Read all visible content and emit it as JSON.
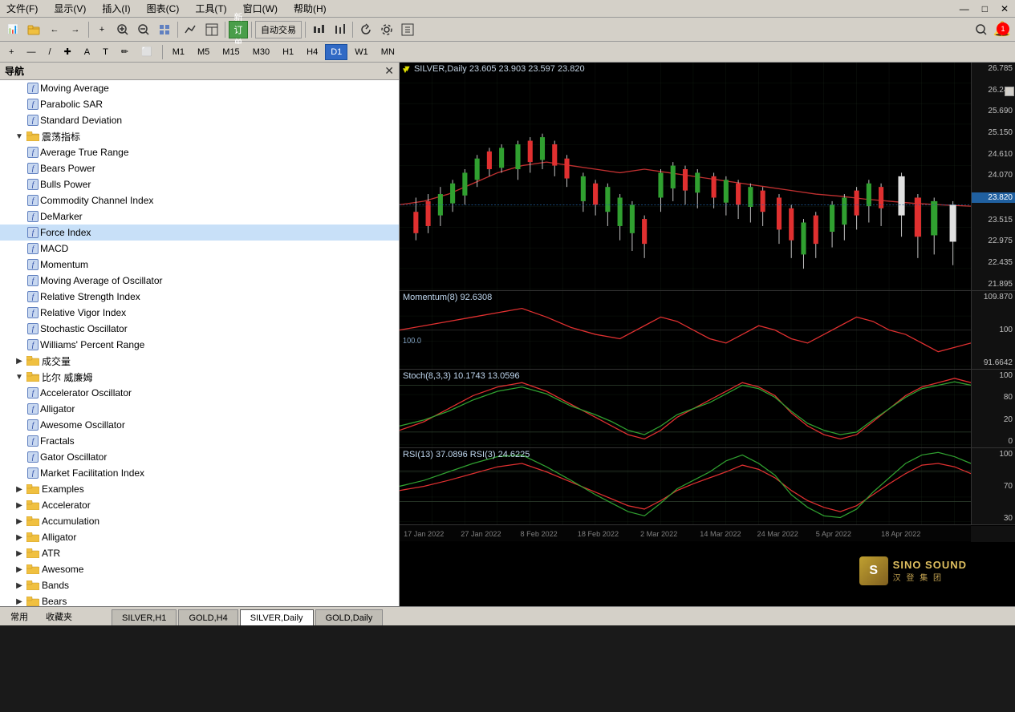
{
  "menubar": {
    "items": [
      "文件(F)",
      "显示(V)",
      "插入(I)",
      "图表(C)",
      "工具(T)",
      "窗口(W)",
      "帮助(H)"
    ]
  },
  "toolbar": {
    "buttons": [
      "⬜",
      "📁",
      "🖹",
      "↩",
      "↪",
      "✂",
      "📋",
      "🗑",
      "📊",
      "📈",
      "🖊",
      "🔷",
      "A",
      "T",
      "✏",
      "☑"
    ],
    "new_order": "新订单",
    "auto_trade": "自动交易"
  },
  "toolbar2": {
    "drawing_tools": [
      "+",
      "—",
      "/",
      "✚",
      "A",
      "T",
      "✏",
      "⬜"
    ],
    "timeframes": [
      "M1",
      "M5",
      "M15",
      "M30",
      "H1",
      "H4",
      "D1",
      "W1",
      "MN"
    ]
  },
  "sidebar": {
    "title": "导航",
    "tabs": [
      "常用",
      "收藏夹"
    ],
    "tree": [
      {
        "id": "moving-average",
        "label": "Moving Average",
        "type": "func",
        "indent": 2
      },
      {
        "id": "parabolic-sar",
        "label": "Parabolic SAR",
        "type": "func",
        "indent": 2
      },
      {
        "id": "standard-deviation",
        "label": "Standard Deviation",
        "type": "func",
        "indent": 2
      },
      {
        "id": "zhenfu",
        "label": "震荡指标",
        "type": "folder-open",
        "indent": 1
      },
      {
        "id": "average-true-range",
        "label": "Average True Range",
        "type": "func",
        "indent": 2
      },
      {
        "id": "bears-power",
        "label": "Bears Power",
        "type": "func",
        "indent": 2
      },
      {
        "id": "bulls-power",
        "label": "Bulls Power",
        "type": "func",
        "indent": 2
      },
      {
        "id": "commodity-channel-index",
        "label": "Commodity Channel Index",
        "type": "func",
        "indent": 2
      },
      {
        "id": "demarker",
        "label": "DeMarker",
        "type": "func",
        "indent": 2
      },
      {
        "id": "force-index",
        "label": "Force Index",
        "type": "func",
        "indent": 2
      },
      {
        "id": "macd",
        "label": "MACD",
        "type": "func",
        "indent": 2
      },
      {
        "id": "momentum",
        "label": "Momentum",
        "type": "func",
        "indent": 2
      },
      {
        "id": "moving-average-oscillator",
        "label": "Moving Average of Oscillator",
        "type": "func",
        "indent": 2
      },
      {
        "id": "relative-strength-index",
        "label": "Relative Strength Index",
        "type": "func",
        "indent": 2
      },
      {
        "id": "relative-vigor-index",
        "label": "Relative Vigor Index",
        "type": "func",
        "indent": 2
      },
      {
        "id": "stochastic-oscillator",
        "label": "Stochastic Oscillator",
        "type": "func",
        "indent": 2
      },
      {
        "id": "williams-percent-range",
        "label": "Williams' Percent Range",
        "type": "func",
        "indent": 2
      },
      {
        "id": "chengjiaoliang",
        "label": "成交量",
        "type": "folder-open",
        "indent": 1
      },
      {
        "id": "bier-william",
        "label": "比尔 威廉姆",
        "type": "folder-open",
        "indent": 1
      },
      {
        "id": "accelerator-oscillator",
        "label": "Accelerator Oscillator",
        "type": "func",
        "indent": 2
      },
      {
        "id": "alligator",
        "label": "Alligator",
        "type": "func",
        "indent": 2
      },
      {
        "id": "awesome-oscillator",
        "label": "Awesome Oscillator",
        "type": "func",
        "indent": 2
      },
      {
        "id": "fractals",
        "label": "Fractals",
        "type": "func",
        "indent": 2
      },
      {
        "id": "gator-oscillator",
        "label": "Gator Oscillator",
        "type": "func",
        "indent": 2
      },
      {
        "id": "market-facilitation-index",
        "label": "Market Facilitation Index",
        "type": "func",
        "indent": 2
      },
      {
        "id": "examples",
        "label": "Examples",
        "type": "folder-open",
        "indent": 1
      },
      {
        "id": "accelerator",
        "label": "Accelerator",
        "type": "folder-open2",
        "indent": 1
      },
      {
        "id": "accumulation",
        "label": "Accumulation",
        "type": "folder-open2",
        "indent": 1
      },
      {
        "id": "alligator2",
        "label": "Alligator",
        "type": "folder-open2",
        "indent": 1
      },
      {
        "id": "atr",
        "label": "ATR",
        "type": "folder-open2",
        "indent": 1
      },
      {
        "id": "awesome",
        "label": "Awesome",
        "type": "folder-open2",
        "indent": 1
      },
      {
        "id": "bands",
        "label": "Bands",
        "type": "folder-open2",
        "indent": 1
      },
      {
        "id": "bears",
        "label": "Bears",
        "type": "folder-open2",
        "indent": 1
      }
    ]
  },
  "chart": {
    "symbol": "SILVER,Daily",
    "ohlc": "23.605  23.903  23.597  23.820",
    "main_panel": {
      "prices": [
        "26.785",
        "26.245",
        "25.690",
        "25.150",
        "24.610",
        "24.070",
        "23.820",
        "23.515",
        "22.975",
        "22.435",
        "21.895"
      ],
      "current_price": "23.820"
    },
    "momentum_panel": {
      "label": "Momentum(8) 92.6308",
      "values": [
        "109.870",
        "100",
        "91.6642"
      ]
    },
    "stoch_panel": {
      "label": "Stoch(8,3,3) 10.1743 13.0596",
      "values": [
        "100",
        "80",
        "20",
        "0"
      ]
    },
    "rsi_panel": {
      "label": "RSI(13) 37.0896  RSI(3) 24.6225",
      "values": [
        "100",
        "70",
        "30"
      ]
    },
    "dates": [
      "17 Jan 2022",
      "27 Jan 2022",
      "8 Feb 2022",
      "18 Feb 2022",
      "2 Mar 2022",
      "14 Mar 2022",
      "24 Mar 2022",
      "5 Apr 2022",
      "18 Apr 2022"
    ]
  },
  "tabs": {
    "bottom": [
      {
        "label": "SILVER,H1",
        "active": false
      },
      {
        "label": "GOLD,H4",
        "active": false
      },
      {
        "label": "SILVER,Daily",
        "active": true
      },
      {
        "label": "GOLD,Daily",
        "active": false
      }
    ],
    "status": [
      "常用",
      "收藏夹"
    ]
  },
  "logo": {
    "text": "SINO SOUND",
    "subtitle": "汉 登 集 团"
  },
  "notification": {
    "count": "1"
  }
}
